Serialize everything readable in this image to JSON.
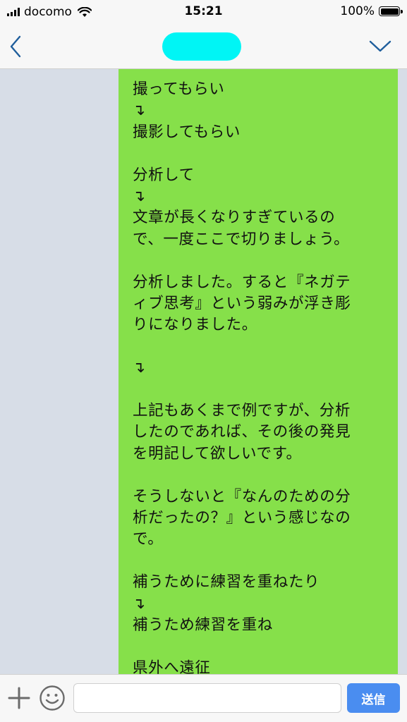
{
  "status_bar": {
    "carrier": "docomo",
    "time": "15:21",
    "battery": "100%",
    "battery_level": 1.0,
    "icons": [
      "signal-icon",
      "wifi-icon",
      "battery-icon"
    ]
  },
  "nav_bar": {
    "back_icon": "chevron-left-icon",
    "menu_icon": "chevron-down-icon",
    "title_redaction_color": "#00f5f5"
  },
  "message": {
    "bubble_color": "#86e04a",
    "lines": [
      "撮ってもらい",
      "↴",
      "撮影してもらい",
      "",
      "分析して",
      "↴",
      "文章が長くなりすぎているの",
      "で、一度ここで切りましょう。",
      "",
      "分析しました。すると『ネガテ",
      "ィブ思考』という弱みが浮き彫",
      "りになりました。",
      "",
      "↴",
      "",
      "上記もあくまで例ですが、分析",
      "したのであれば、その後の発見",
      "を明記して欲しいです。",
      "",
      "そうしないと『なんのための分",
      "析だったの？』という感じなの",
      "で。",
      "",
      "補うために練習を重ねたり",
      "↴",
      "補うため練習を重ね",
      "",
      "県外へ遠征"
    ]
  },
  "input_bar": {
    "plus_icon": "plus-icon",
    "emoji_icon": "smiley-icon",
    "input_value": "",
    "input_placeholder": "",
    "send_label": "送信",
    "send_color": "#4a8df0"
  }
}
